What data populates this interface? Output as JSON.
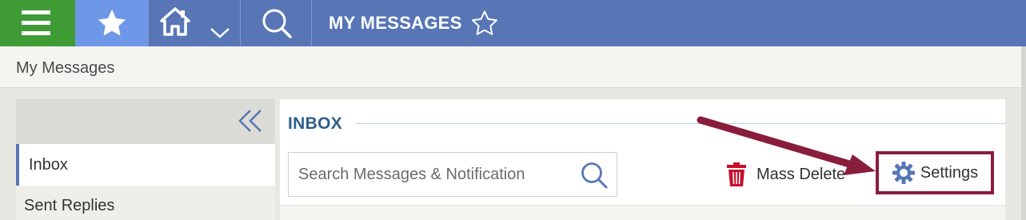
{
  "topbar": {
    "menu_icon": "hamburger-menu-icon",
    "favorites_icon": "star-filled-icon",
    "home_icon": "home-icon",
    "home_dropdown_icon": "chevron-down-icon",
    "search_icon": "search-icon",
    "title": "MY MESSAGES",
    "favorite_toggle_icon": "star-outline-icon",
    "colors": {
      "bar": "#5876b6",
      "menu": "#3f9c35",
      "active": "#6e97e8"
    }
  },
  "breadcrumb": {
    "label": "My Messages"
  },
  "sidebar": {
    "collapse_icon": "double-chevron-left-icon",
    "items": [
      {
        "label": "Inbox",
        "active": true
      },
      {
        "label": "Sent Replies",
        "active": false
      }
    ]
  },
  "main": {
    "title": "INBOX",
    "search": {
      "placeholder": "Search Messages & Notification",
      "value": ""
    },
    "mass_delete": {
      "label": "Mass Delete",
      "icon": "trash-icon"
    },
    "settings": {
      "label": "Settings",
      "icon": "gear-icon"
    },
    "annotation_color": "#8a1d3c"
  }
}
